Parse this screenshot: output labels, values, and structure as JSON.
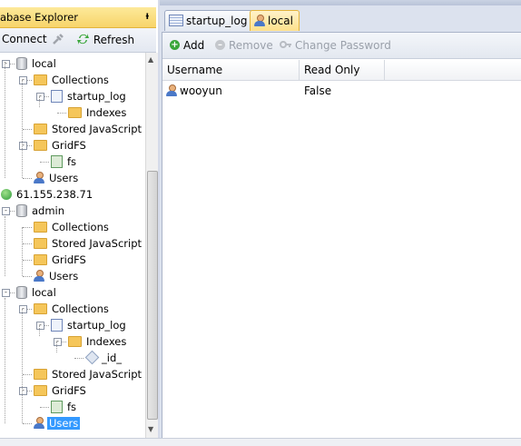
{
  "explorer": {
    "title": "abase Explorer",
    "pin_glyph": "ᵼ",
    "connect_label": "Connect",
    "refresh_label": "Refresh"
  },
  "tree": [
    {
      "label": "local",
      "icon": "database-icon",
      "depth": 0,
      "expander": "-"
    },
    {
      "label": "Collections",
      "icon": "folder-icon",
      "depth": 1,
      "expander": "-"
    },
    {
      "label": "startup_log",
      "icon": "collection-icon",
      "depth": 2,
      "expander": "-"
    },
    {
      "label": "Indexes",
      "icon": "folder-icon",
      "depth": 3
    },
    {
      "label": "Stored JavaScript",
      "icon": "folder-icon",
      "depth": 1
    },
    {
      "label": "GridFS",
      "icon": "folder-icon",
      "depth": 1,
      "expander": "-"
    },
    {
      "label": "fs",
      "icon": "gridfs-icon",
      "depth": 2
    },
    {
      "label": "Users",
      "icon": "user-icon",
      "depth": 1
    },
    {
      "label": "61.155.238.71",
      "icon": "server-globe-icon",
      "depth": -1
    },
    {
      "label": "admin",
      "icon": "database-icon",
      "depth": 0,
      "expander": "-"
    },
    {
      "label": "Collections",
      "icon": "folder-icon",
      "depth": 1
    },
    {
      "label": "Stored JavaScript",
      "icon": "folder-icon",
      "depth": 1
    },
    {
      "label": "GridFS",
      "icon": "folder-icon",
      "depth": 1
    },
    {
      "label": "Users",
      "icon": "user-icon",
      "depth": 1
    },
    {
      "label": "local",
      "icon": "database-icon",
      "depth": 0,
      "expander": "-"
    },
    {
      "label": "Collections",
      "icon": "folder-icon",
      "depth": 1,
      "expander": "-"
    },
    {
      "label": "startup_log",
      "icon": "collection-icon",
      "depth": 2,
      "expander": "-"
    },
    {
      "label": "Indexes",
      "icon": "folder-icon",
      "depth": 3,
      "expander": "-"
    },
    {
      "label": "_id_",
      "icon": "index-icon",
      "depth": 4
    },
    {
      "label": "Stored JavaScript",
      "icon": "folder-icon",
      "depth": 1
    },
    {
      "label": "GridFS",
      "icon": "folder-icon",
      "depth": 1,
      "expander": "-"
    },
    {
      "label": "fs",
      "icon": "gridfs-icon",
      "depth": 2
    },
    {
      "label": "Users",
      "icon": "user-icon",
      "depth": 1,
      "selected": true
    }
  ],
  "tabs": [
    {
      "label": "startup_log",
      "icon": "table-icon",
      "active": false
    },
    {
      "label": "local",
      "icon": "user-icon",
      "active": true
    }
  ],
  "users_toolbar": {
    "add_label": "Add",
    "remove_label": "Remove",
    "change_password_label": "Change Password"
  },
  "users_table": {
    "columns": [
      "Username",
      "Read Only"
    ],
    "rows": [
      {
        "username": "wooyun",
        "read_only": "False"
      }
    ]
  },
  "colors": {
    "selection": "#3399ff",
    "panel_title": "#f7d46a",
    "add_green": "#3aa63a"
  }
}
